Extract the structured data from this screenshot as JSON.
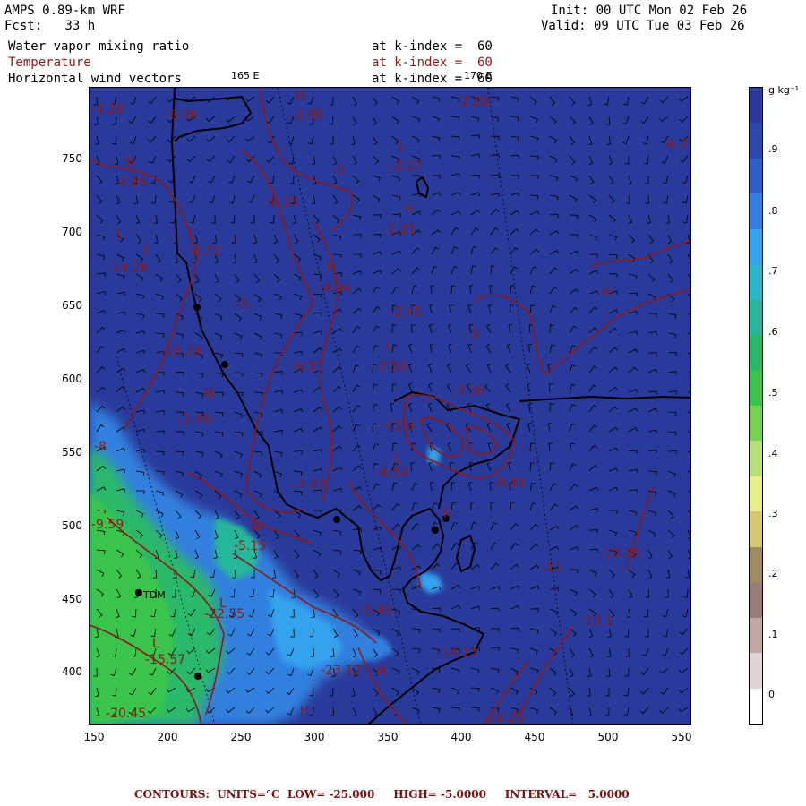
{
  "header": {
    "model": "AMPS 0.89-km WRF",
    "forecast": "Fcst:   33 h",
    "init": "Init: 00 UTC Mon 02 Feb 26",
    "valid": "Valid: 09 UTC Tue 03 Feb 26",
    "field1": "Water vapor mixing ratio",
    "field2": "Temperature",
    "field3": "Horizontal wind vectors",
    "level1": "at k-index =  60",
    "level2": "at k-index =  60",
    "level3": "at k-index =  60"
  },
  "lon_labels": [
    "165 E",
    "170 E"
  ],
  "axes": {
    "x_ticks": [
      "150",
      "200",
      "250",
      "300",
      "350",
      "400",
      "450",
      "500",
      "550"
    ],
    "y_ticks": [
      "750",
      "700",
      "650",
      "600",
      "550",
      "500",
      "450",
      "400"
    ]
  },
  "colorbar": {
    "unit": "g kg⁻¹",
    "labels": [
      ".9",
      ".8",
      ".7",
      ".6",
      ".5",
      ".4",
      ".3",
      ".2",
      ".1",
      "0"
    ],
    "colors": [
      "#2a3a9a",
      "#2b48ad",
      "#2e5fc8",
      "#3280de",
      "#35a2ee",
      "#2ab6c9",
      "#26b79a",
      "#2cb86a",
      "#3bc44b",
      "#79d152",
      "#b8e076",
      "#e9ef88",
      "#d8c770",
      "#a08a5e",
      "#9a7c78",
      "#c3a6a4",
      "#e0d4d4",
      "#ffffff"
    ]
  },
  "temperature_labels": [
    "-4.28",
    "-6.06",
    "-2.95",
    "-2.08",
    "-4.86",
    "-5",
    "-2.17",
    "-6.33",
    "-2.21",
    "-6.71",
    "-14.28",
    "-5",
    "-4.44",
    "-2.45",
    "-5",
    "-16.14",
    "-6.57",
    "-7.50",
    "-7.36",
    "-2.96",
    "-12.8",
    "-4.58",
    "-9.49",
    "-7.47",
    "-5.15",
    "-10.06",
    "-22.55",
    "-5.45",
    "-10.1",
    "-15.57",
    "-23.12",
    "-20.45",
    "-16.25",
    "-14.13",
    "-11",
    "-8",
    "-7",
    "-6",
    "-9.59",
    "-4",
    "H",
    "L",
    "H",
    "L",
    "H",
    "L",
    "L",
    "H",
    "L",
    "H",
    "L",
    "H",
    "L",
    "H",
    "L",
    "L",
    "H",
    "H"
  ],
  "station_label": "TDM",
  "footer": "CONTOURS:  UNITS=°C  LOW= -25.000     HIGH= -5.0000     INTERVAL=   5.0000"
}
